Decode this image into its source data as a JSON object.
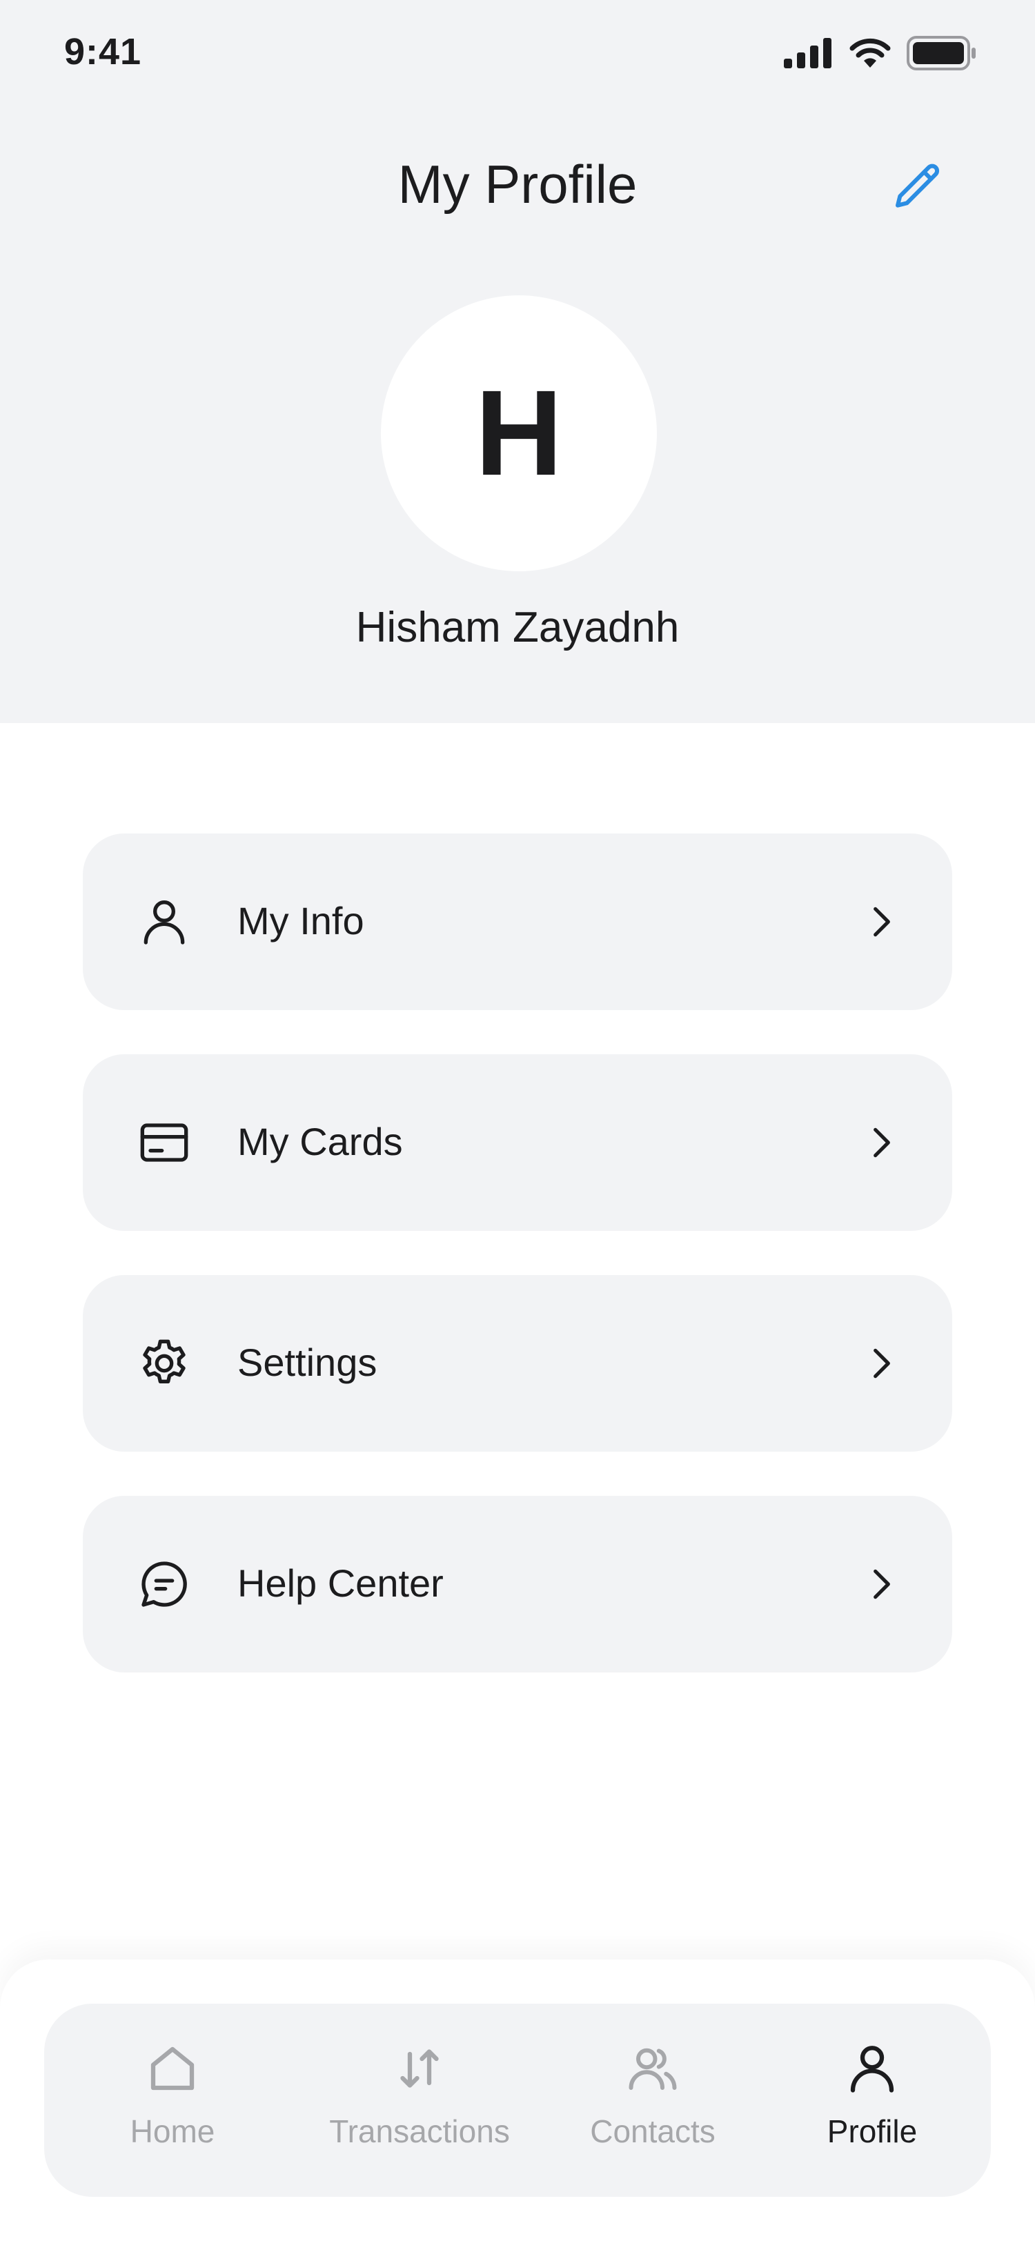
{
  "status_bar": {
    "time": "9:41"
  },
  "header": {
    "title": "My Profile",
    "edit_icon": "pencil-icon",
    "accent_color": "#2b8de3"
  },
  "profile": {
    "avatar_initial": "H",
    "name": "Hisham Zayadnh"
  },
  "menu": [
    {
      "label": "My Info",
      "icon": "user-icon"
    },
    {
      "label": "My Cards",
      "icon": "credit-card-icon"
    },
    {
      "label": "Settings",
      "icon": "gear-icon"
    },
    {
      "label": "Help Center",
      "icon": "chat-bubble-icon"
    }
  ],
  "tab_bar": {
    "items": [
      {
        "label": "Home",
        "icon": "home-icon",
        "active": false
      },
      {
        "label": "Transactions",
        "icon": "arrows-up-down-icon",
        "active": false
      },
      {
        "label": "Contacts",
        "icon": "contacts-icon",
        "active": false
      },
      {
        "label": "Profile",
        "icon": "user-icon",
        "active": true
      }
    ],
    "active_color": "#1c1c1e",
    "inactive_color": "#a6a7aa"
  }
}
